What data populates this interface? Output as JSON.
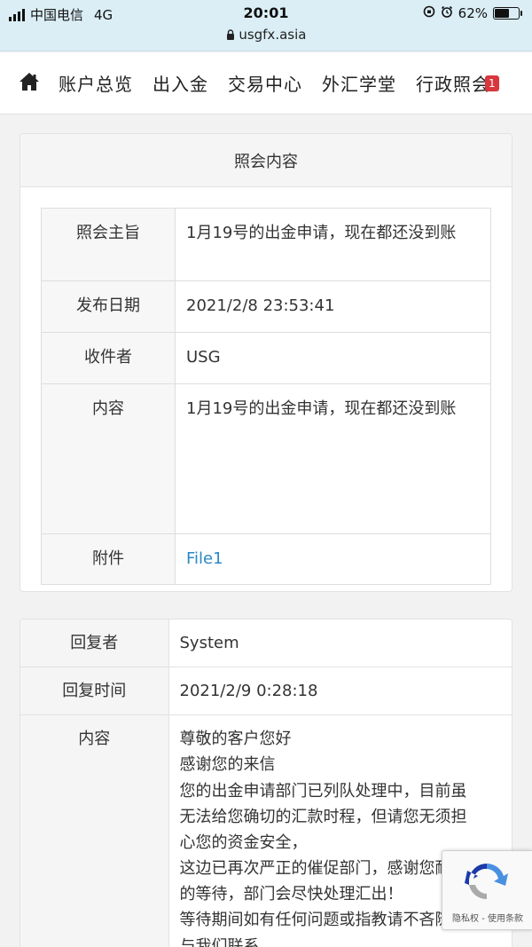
{
  "status_bar": {
    "carrier": "中国电信",
    "network": "4G",
    "time": "20:01",
    "url": "usgfx.asia",
    "battery": "62%",
    "battery_level": 0.62
  },
  "nav": {
    "items": [
      "账户总览",
      "出入金",
      "交易中心",
      "外汇学堂",
      "行政照会"
    ],
    "badge": "1"
  },
  "inquiry": {
    "title": "照会内容",
    "rows": [
      {
        "label": "照会主旨",
        "value": "1月19号的出金申请，现在都还没到账"
      },
      {
        "label": "发布日期",
        "value": "2021/2/8 23:53:41"
      },
      {
        "label": "收件者",
        "value": "USG"
      },
      {
        "label": "内容",
        "value": "1月19号的出金申请，现在都还没到账"
      },
      {
        "label": "附件",
        "value": "File1"
      }
    ]
  },
  "reply": {
    "rows": [
      {
        "label": "回复者",
        "value": "System"
      },
      {
        "label": "回复时间",
        "value": "2021/2/9 0:28:18"
      }
    ],
    "content_label": "内容",
    "content_lines": [
      "尊敬的客户您好",
      "感谢您的来信",
      "您的出金申请部门已列队处理中，目前虽无法给您确切的汇款时程，但请您无须担心您的资金安全，",
      "这边已再次严正的催促部门，感谢您耐心的等待，部门会尽快处理汇出！",
      "等待期间如有任何问题或指教请不吝随时与我们联系"
    ]
  },
  "recaptcha": {
    "links": "隐私权 - 使用条款"
  },
  "colors": {
    "status_bg": "#dbeef6",
    "link": "#2a89c6",
    "badge": "#d9363e"
  }
}
